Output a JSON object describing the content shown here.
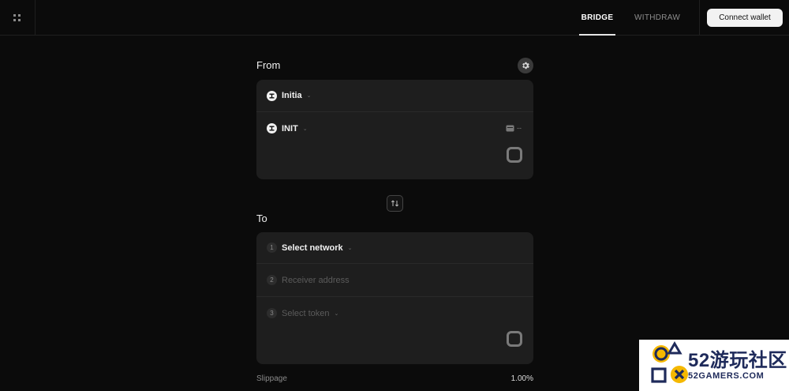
{
  "nav": {
    "tabs": [
      {
        "label": "BRIDGE",
        "active": true
      },
      {
        "label": "WITHDRAW",
        "active": false
      }
    ],
    "connect_label": "Connect wallet"
  },
  "icons": {
    "menu": "grid-dots-icon",
    "settings": "gear-icon",
    "chain": "initia-logo-icon",
    "swap": "swap-arrows-icon",
    "wallet": "wallet-icon"
  },
  "from": {
    "label": "From",
    "chain": "Initia",
    "token": "INIT",
    "balance": "--"
  },
  "to": {
    "label": "To",
    "steps": [
      {
        "num": "1",
        "text": "Select network"
      },
      {
        "num": "2",
        "text": "Receiver address"
      },
      {
        "num": "3",
        "text": "Select token"
      }
    ]
  },
  "slippage": {
    "label": "Slippage",
    "value": "1.00%"
  },
  "watermark": {
    "big": "52游玩社区",
    "small": "52GAMERS.COM"
  },
  "colors": {
    "background": "#0b0b0b",
    "card": "#1e1e1e",
    "accent": "#f2f2f2",
    "watermark_yellow": "#f5b800",
    "watermark_navy": "#1e2a5a"
  }
}
